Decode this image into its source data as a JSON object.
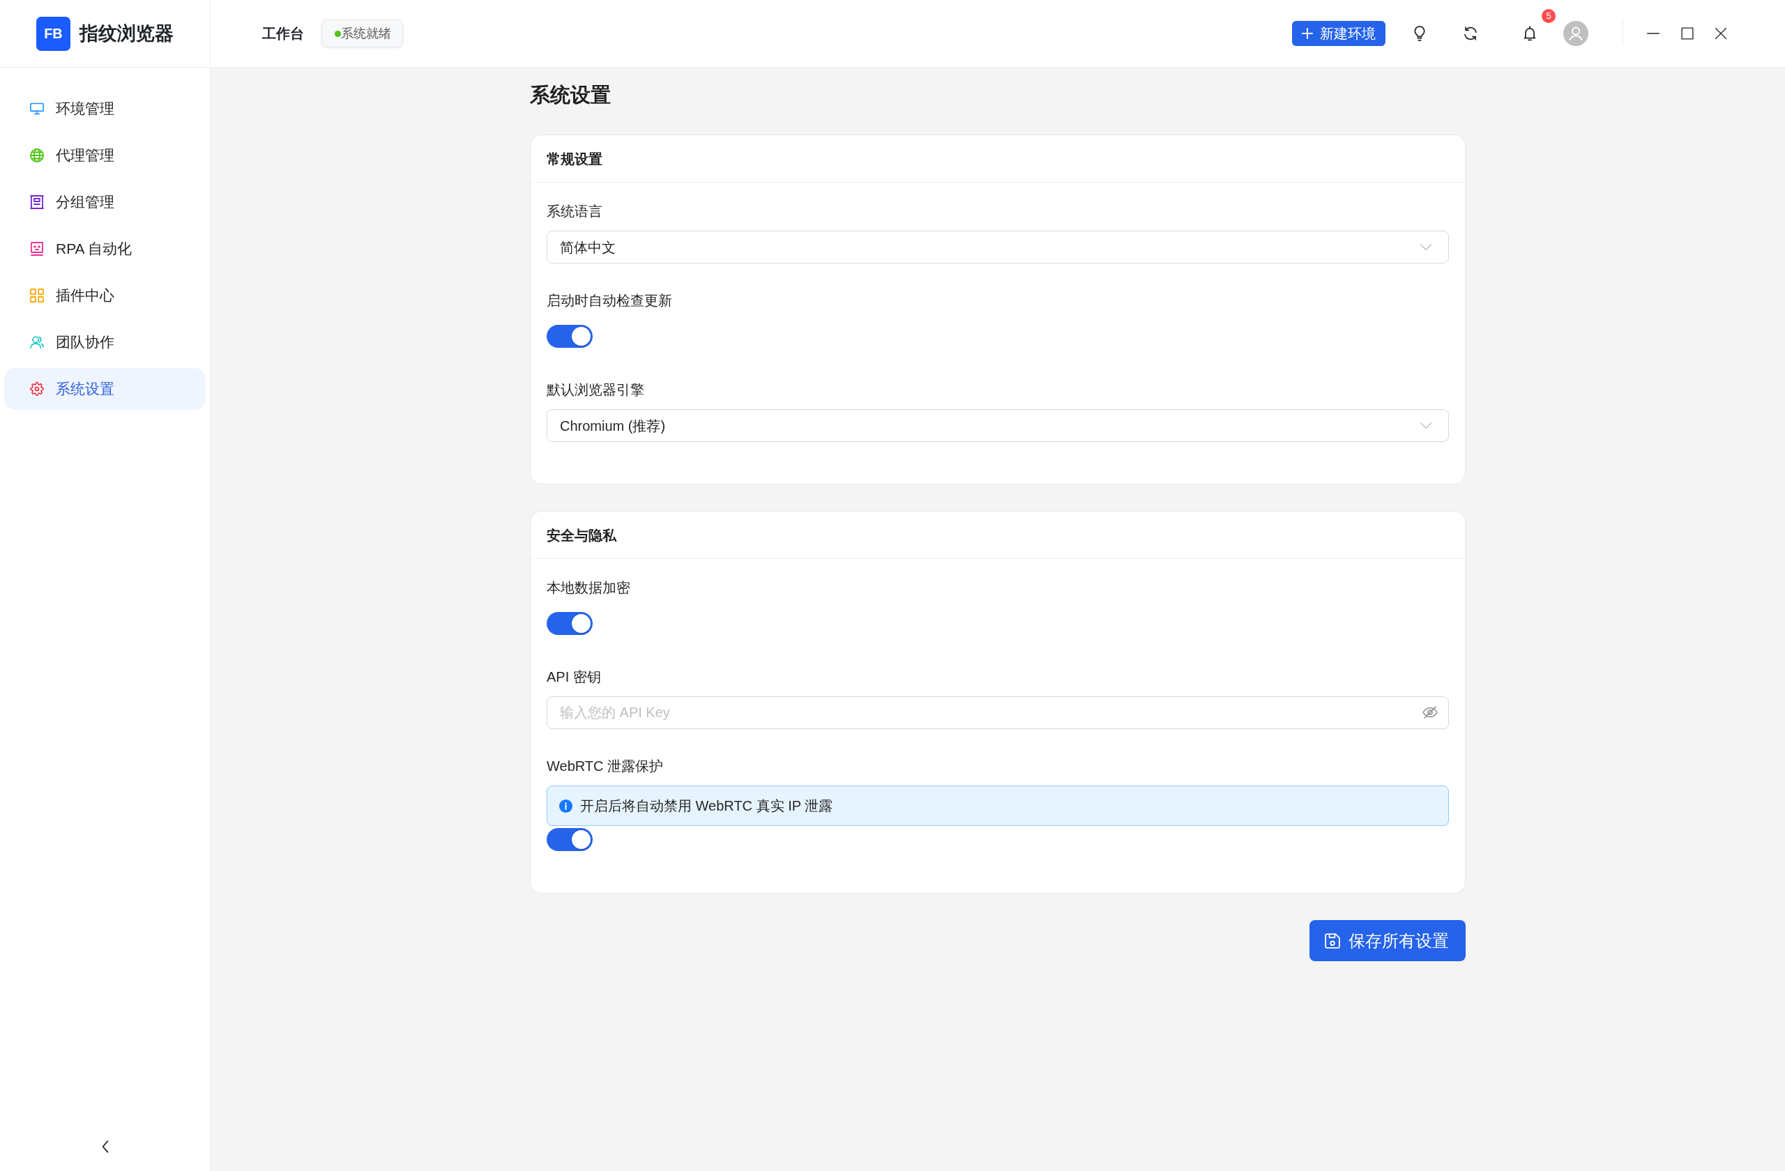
{
  "app": {
    "logo": "FB",
    "name": "指纹浏览器"
  },
  "header": {
    "title": "工作台",
    "status": "系统就绪",
    "new_button": "新建环境",
    "notification_count": "5"
  },
  "sidebar": {
    "items": [
      {
        "label": "环境管理",
        "color": "#1890ff",
        "selected": false
      },
      {
        "label": "代理管理",
        "color": "#52c41a",
        "selected": false
      },
      {
        "label": "分组管理",
        "color": "#722ed1",
        "selected": false
      },
      {
        "label": "RPA 自动化",
        "color": "#eb2f96",
        "selected": false
      },
      {
        "label": "插件中心",
        "color": "#faad14",
        "selected": false
      },
      {
        "label": "团队协作",
        "color": "#13c2c2",
        "selected": false
      },
      {
        "label": "系统设置",
        "color": "#f5222d",
        "selected": true
      }
    ]
  },
  "page": {
    "title": "系统设置"
  },
  "sections": [
    {
      "title": "常规设置",
      "fields": [
        {
          "kind": "select",
          "label": "系统语言",
          "value": "简体中文"
        },
        {
          "kind": "toggle",
          "label": "启动时自动检查更新",
          "on": true
        },
        {
          "kind": "select",
          "label": "默认浏览器引擎",
          "value": "Chromium (推荐)"
        }
      ]
    },
    {
      "title": "安全与隐私",
      "fields": [
        {
          "kind": "toggle",
          "label": "本地数据加密",
          "on": true
        },
        {
          "kind": "password",
          "label": "API 密钥",
          "placeholder": "输入您的 API Key"
        },
        {
          "kind": "toggle",
          "label": "WebRTC 泄露保护",
          "note": "开启后将自动禁用 WebRTC 真实 IP 泄露",
          "on": true
        }
      ]
    }
  ],
  "save_button": "保存所有设置"
}
